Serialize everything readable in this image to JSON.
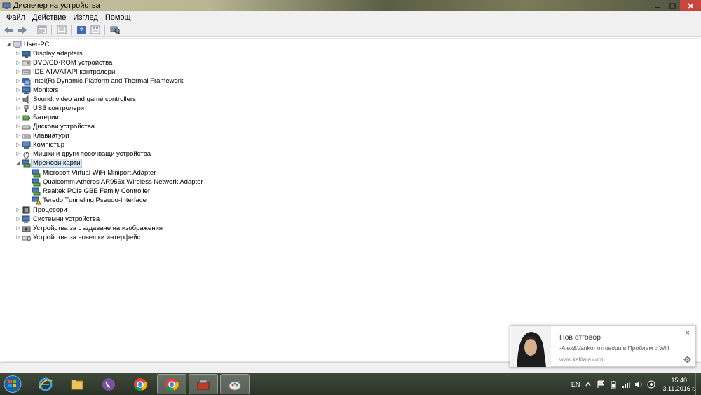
{
  "window": {
    "title": "Диспечер на устройства"
  },
  "menu": [
    "Файл",
    "Действие",
    "Изглед",
    "Помощ"
  ],
  "toolbar": {
    "buttons": [
      "back-icon",
      "forward-icon",
      "properties-icon",
      "view-icon",
      "help-icon",
      "view-icon-2",
      "scan-hardware-icon"
    ]
  },
  "tree": {
    "root": "User-PC",
    "categories": [
      {
        "label": "Display adapters",
        "icon": "display-adapter-icon"
      },
      {
        "label": "DVD/CD-ROM устройства",
        "icon": "dvd-drive-icon"
      },
      {
        "label": "IDE ATA/ATAPI контролери",
        "icon": "ide-controller-icon"
      },
      {
        "label": "Intel(R) Dynamic Platform and Thermal Framework",
        "icon": "chip-icon"
      },
      {
        "label": "Monitors",
        "icon": "monitor-icon"
      },
      {
        "label": "Sound, video and game controllers",
        "icon": "speaker-icon"
      },
      {
        "label": "USB контролери",
        "icon": "usb-icon"
      },
      {
        "label": "Батерии",
        "icon": "battery-icon"
      },
      {
        "label": "Дискови устройства",
        "icon": "disk-drive-icon"
      },
      {
        "label": "Клавиатури",
        "icon": "keyboard-icon"
      },
      {
        "label": "Компютър",
        "icon": "computer-icon"
      },
      {
        "label": "Мишки и други посочващи устройства",
        "icon": "mouse-icon"
      },
      {
        "label": "Мрежови карти",
        "icon": "network-adapter-icon",
        "expanded": true,
        "selected": true,
        "children": [
          {
            "label": "Microsoft Virtual WiFi Miniport Adapter",
            "icon": "network-adapter-icon"
          },
          {
            "label": "Qualcomm Atheros AR956x Wireless Network Adapter",
            "icon": "network-adapter-icon"
          },
          {
            "label": "Realtek PCIe GBE Family Controller",
            "icon": "network-adapter-icon"
          },
          {
            "label": "Teredo Tunneling Pseudo-Interface",
            "icon": "network-adapter-warning-icon"
          }
        ]
      },
      {
        "label": "Процесори",
        "icon": "processor-icon"
      },
      {
        "label": "Системни устройства",
        "icon": "system-device-icon"
      },
      {
        "label": "Устройства за създаване на изображения",
        "icon": "camera-icon"
      },
      {
        "label": "Устройства за човешки интерфейс",
        "icon": "hid-icon"
      }
    ]
  },
  "notification": {
    "title": "Нов отговор",
    "body": "-Alex&Vanko- отговори в Проблем с Wifi",
    "site": "www.kaldata.com",
    "close": "×"
  },
  "taskbar": {
    "apps": [
      "internet-explorer-icon",
      "file-explorer-icon",
      "viber-icon",
      "chrome-icon",
      "chrome-icon-2",
      "device-manager-icon",
      "paint-icon"
    ],
    "language": "EN",
    "time": "15:40",
    "date": "3.11.2016 г."
  },
  "colors": {
    "selection": "#dceaf8",
    "close_button": "#c8463b",
    "taskbar": "#2a3227"
  }
}
